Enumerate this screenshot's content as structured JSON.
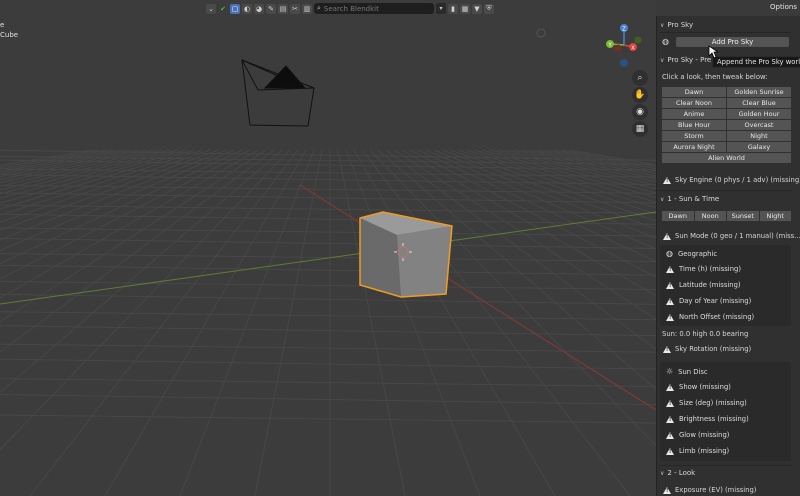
{
  "header": {
    "search_placeholder": "Search Blendkit",
    "options_label": "Options"
  },
  "outliner_hint": {
    "line1": "e",
    "line2": "Cube"
  },
  "colors": {
    "accent": "#4772b3",
    "selection_outline": "#f29b1e",
    "axis_x": "#d9433c",
    "axis_y": "#7cba32",
    "gizmo_z": "#4a82cf"
  },
  "sidebar": {
    "pro_sky_header": "Pro Sky",
    "add_button": "Add Pro Sky",
    "tooltip": "Append the Pro Sky world a",
    "pro_sky_presets_header": "Pro Sky - Pre",
    "presets_hint": "Click a look, then tweak below:",
    "presets": [
      "Dawn",
      "Golden Sunrise",
      "Clear Noon",
      "Clear Blue",
      "Anime",
      "Golden Hour",
      "Blue Hour",
      "Overcast",
      "Storm",
      "Night",
      "Aurora Night",
      "Galaxy"
    ],
    "preset_wide": "Alien World",
    "sky_engine": "Sky Engine (0 phys / 1 adv)  (missing)",
    "sun_time_header": "1 - Sun & Time",
    "time_buttons": [
      "Dawn",
      "Noon",
      "Sunset",
      "Night"
    ],
    "sun_mode": "Sun Mode (0 geo / 1 manual)  (miss...",
    "geo_title": "Geographic",
    "geo_items": [
      "Time (h)  (missing)",
      "Latitude  (missing)",
      "Day of Year  (missing)",
      "North Offset  (missing)"
    ],
    "sun_info": "Sun: 0.0 high  0.0 bearing",
    "sky_rotation": "Sky Rotation  (missing)",
    "sun_disc_title": "Sun Disc",
    "disc_items": [
      "Show  (missing)",
      "Size (deg)  (missing)",
      "Brightness  (missing)",
      "Glow  (missing)",
      "Limb  (missing)"
    ],
    "look_header": "2 - Look",
    "exposure": "Exposure (EV)  (missing)"
  },
  "gizmo": {
    "y": "Y",
    "x": "X",
    "z": "Z"
  }
}
